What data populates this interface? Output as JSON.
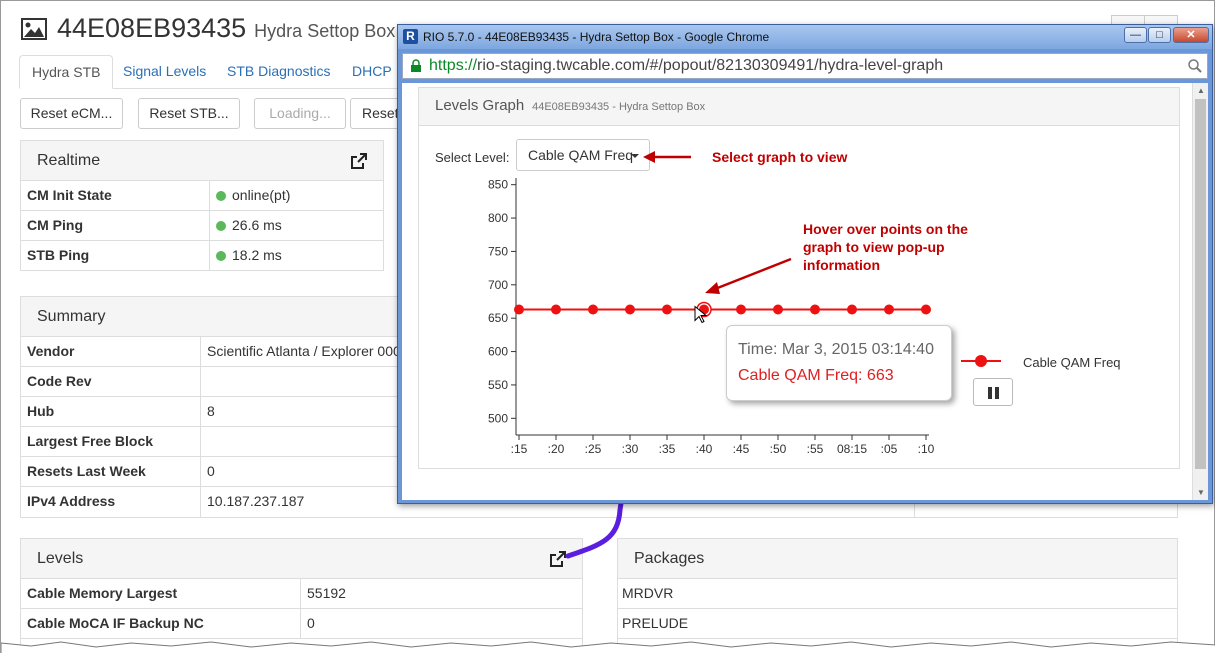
{
  "header": {
    "title": "44E08EB93435",
    "subtitle": "Hydra Settop Box"
  },
  "tabs": [
    {
      "label": "Hydra STB"
    },
    {
      "label": "Signal Levels"
    },
    {
      "label": "STB Diagnostics"
    },
    {
      "label": "DHCP"
    }
  ],
  "buttons": [
    {
      "label": "Reset eCM..."
    },
    {
      "label": "Reset STB..."
    },
    {
      "label": "Loading..."
    },
    {
      "label": "Reset"
    }
  ],
  "realtime": {
    "title": "Realtime",
    "rows": [
      {
        "key": "CM Init State",
        "value": "online(pt)"
      },
      {
        "key": "CM Ping",
        "value": "26.6 ms"
      },
      {
        "key": "STB Ping",
        "value": "18.2 ms"
      }
    ]
  },
  "summary": {
    "title": "Summary",
    "rows": [
      {
        "key": "Vendor",
        "value": "Scientific Atlanta / Explorer 0000"
      },
      {
        "key": "Code Rev",
        "value": ""
      },
      {
        "key": "Hub",
        "value": "8"
      },
      {
        "key": "Largest Free Block",
        "value": ""
      },
      {
        "key": "Resets Last Week",
        "value": "0"
      },
      {
        "key": "IPv4 Address",
        "value": "10.187.237.187"
      }
    ]
  },
  "levels": {
    "title": "Levels",
    "rows": [
      {
        "key": "Cable Memory Largest",
        "value": "55192"
      },
      {
        "key": "Cable MoCA IF Backup NC",
        "value": "0"
      }
    ]
  },
  "packages": {
    "title": "Packages",
    "items": [
      "MRDVR",
      "PRELUDE"
    ]
  },
  "popup": {
    "window_title": "RIO 5.7.0 - 44E08EB93435 - Hydra Settop Box - Google Chrome",
    "app_icon_letter": "R",
    "url_scheme": "https://",
    "url_rest": "rio-staging.twcable.com/#/popout/82130309491/hydra-level-graph",
    "panel_title": "Levels Graph",
    "panel_subtitle": "44E08EB93435 - Hydra Settop Box",
    "select_label": "Select Level:",
    "select_value": "Cable QAM Freq",
    "tooltip_time": "Time: Mar 3, 2015 03:14:40",
    "tooltip_value": "Cable QAM Freq: 663"
  },
  "annotations": {
    "select_graph": "Select graph to view",
    "hover_line1": "Hover over points on the",
    "hover_line2": "graph to view pop-up",
    "hover_line3": "information"
  },
  "colors": {
    "series": "#ee1111",
    "annotation": "#c00000",
    "arrow_purple": "#5a1ee0",
    "link": "#2a6fb7",
    "status_ok": "#5cb85c"
  },
  "chart_data": {
    "type": "line",
    "x": [
      ":15",
      ":20",
      ":25",
      ":30",
      ":35",
      ":40",
      ":45",
      ":50",
      ":55",
      "08:15",
      ":05",
      ":10"
    ],
    "series": [
      {
        "name": "Cable QAM Freq",
        "values": [
          663,
          663,
          663,
          663,
          663,
          663,
          663,
          663,
          663,
          663,
          663,
          663
        ]
      }
    ],
    "yticks": [
      500,
      550,
      600,
      650,
      700,
      750,
      800,
      850
    ],
    "ylim": [
      475,
      860
    ],
    "highlighted_index": 5,
    "legend": "right",
    "grid": false
  }
}
